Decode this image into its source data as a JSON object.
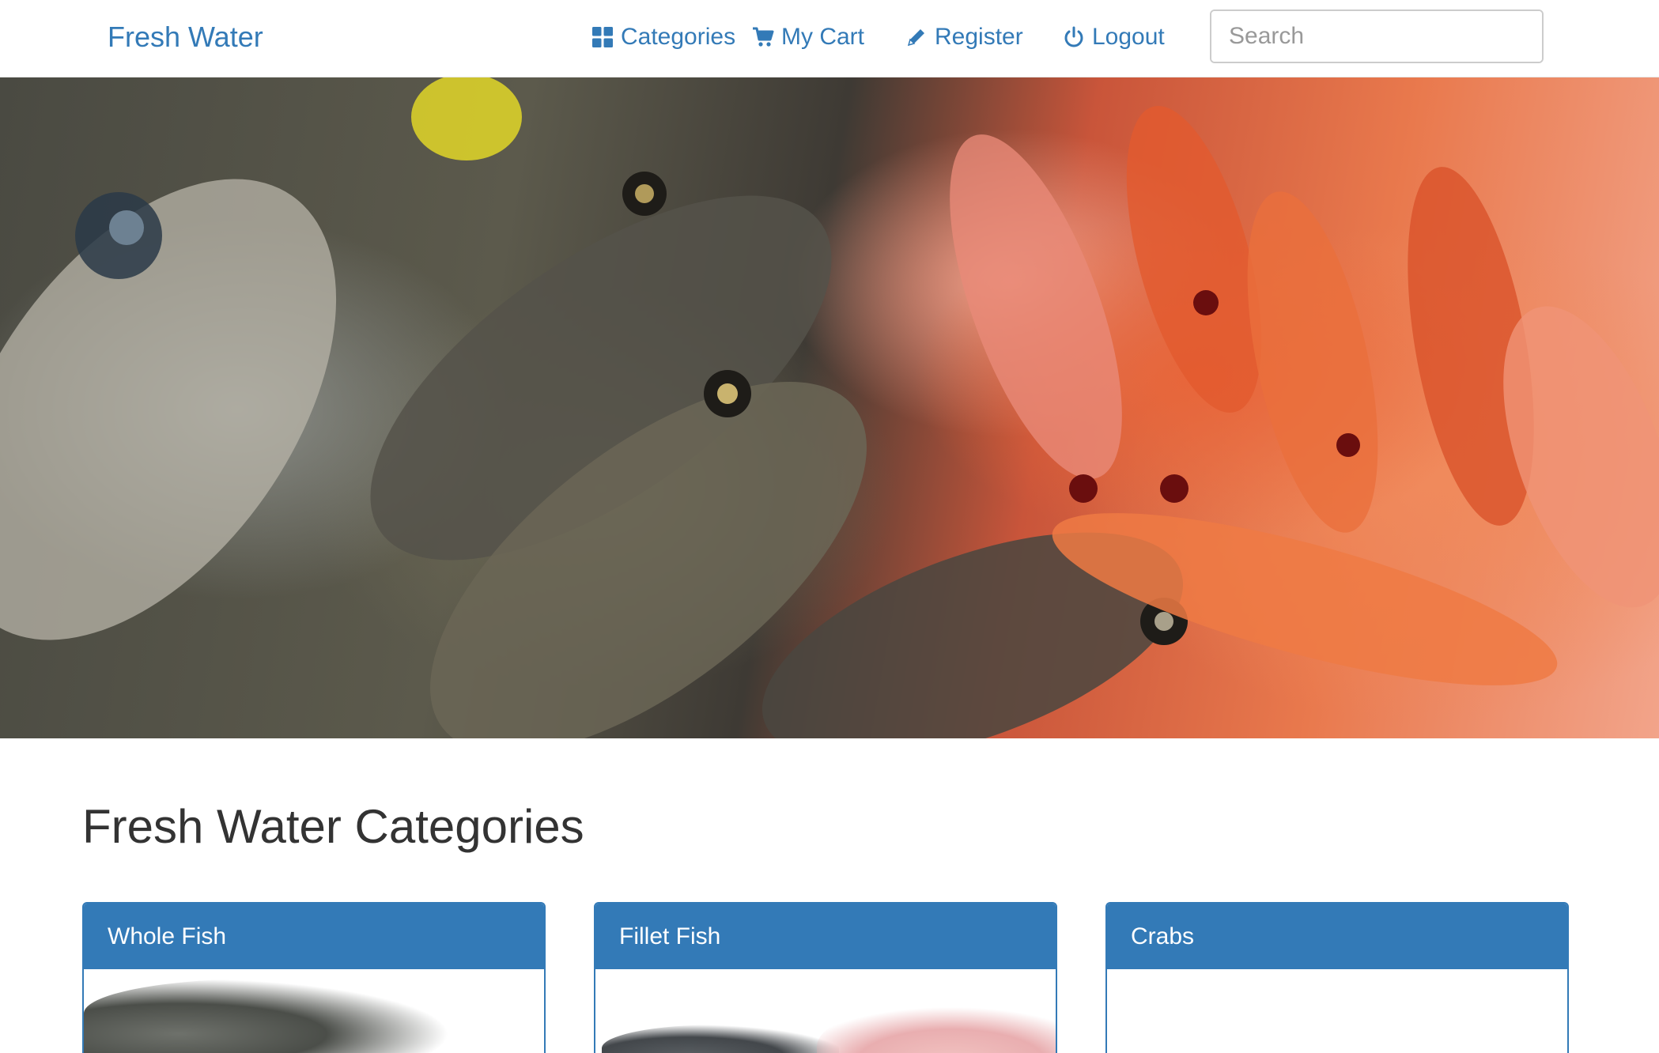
{
  "navbar": {
    "brand": "Fresh Water",
    "links": {
      "categories": "Categories",
      "cart": "My Cart",
      "register": "Register",
      "logout": "Logout"
    },
    "search": {
      "placeholder": "Search",
      "value": ""
    },
    "icons": {
      "categories": "grid-icon",
      "cart": "cart-icon",
      "register": "pencil-icon",
      "logout": "power-icon",
      "search": "search-icon"
    }
  },
  "hero": {
    "image": "fish-market-photo"
  },
  "main": {
    "section_title": "Fresh Water Categories",
    "categories": [
      {
        "label": "Whole Fish",
        "image": "whole-fish-photo"
      },
      {
        "label": "Fillet Fish",
        "image": "fillet-fish-photo"
      },
      {
        "label": "Crabs",
        "image": "crabs-photo"
      }
    ]
  },
  "colors": {
    "accent": "#337ab7",
    "text": "#333333",
    "border": "#cccccc"
  }
}
